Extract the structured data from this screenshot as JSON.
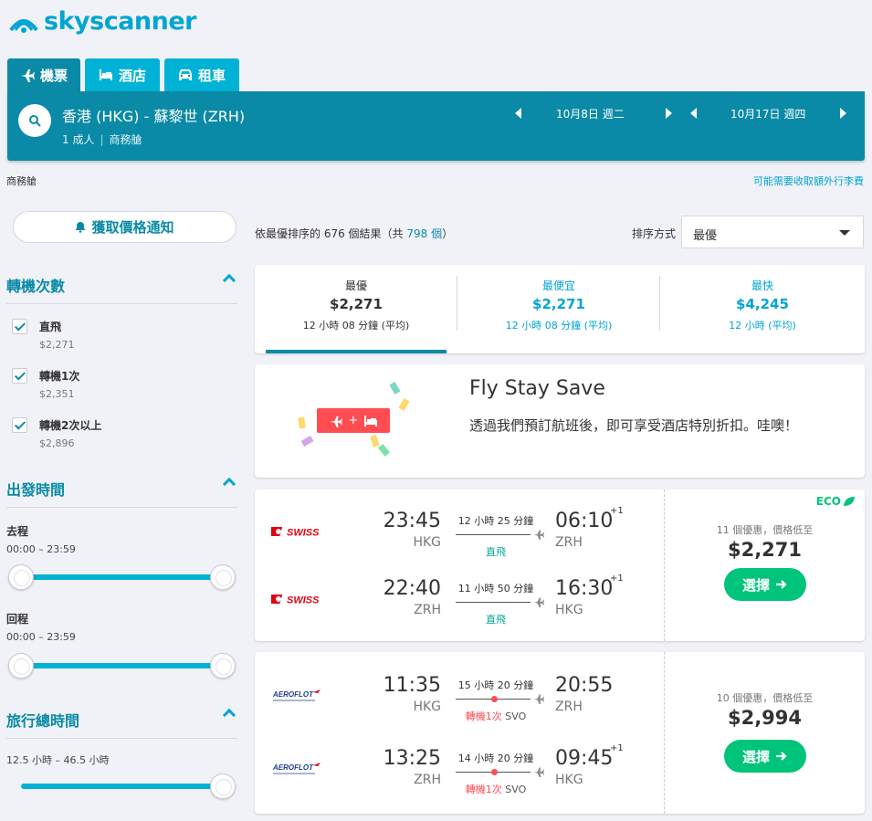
{
  "brand": {
    "name": "skyscanner",
    "color": "#00a5d2"
  },
  "tabs": [
    {
      "label": "機票",
      "icon": "plane-icon",
      "active": true
    },
    {
      "label": "酒店",
      "icon": "bed-icon",
      "active": false
    },
    {
      "label": "租車",
      "icon": "car-icon",
      "active": false
    }
  ],
  "search": {
    "route": "香港 (HKG) - 蘇黎世 (ZRH)",
    "passengers": "1 成人",
    "cabin": "商務艙",
    "depart_date": "10月8日 週二",
    "return_date": "10月17日 週四"
  },
  "cabin_label": "商務艙",
  "baggage_link": "可能需要收取額外行李費",
  "sidebar": {
    "alert_button": "獲取價格通知",
    "stops": {
      "title": "轉機次數",
      "options": [
        {
          "label": "直飛",
          "price": "$2,271",
          "checked": true
        },
        {
          "label": "轉機1次",
          "price": "$2,351",
          "checked": true
        },
        {
          "label": "轉機2次以上",
          "price": "$2,896",
          "checked": true
        }
      ]
    },
    "departure": {
      "title": "出發時間",
      "outbound_label": "去程",
      "outbound_range": "00:00 – 23:59",
      "return_label": "回程",
      "return_range": "00:00 – 23:59"
    },
    "duration": {
      "title": "旅行總時間",
      "range": "12.5 小時 – 46.5 小時"
    }
  },
  "results": {
    "count_prefix": "依最優排序的 676 個結果（共 ",
    "total": "798 個",
    "count_suffix": "）",
    "sort_label": "排序方式",
    "sort_value": "最優"
  },
  "sort_tabs": [
    {
      "title": "最優",
      "price": "$2,271",
      "time": "12 小時 08 分鐘 (平均)",
      "active": true
    },
    {
      "title": "最便宜",
      "price": "$2,271",
      "time": "12 小時 08 分鐘 (平均)",
      "active": false
    },
    {
      "title": "最快",
      "price": "$4,245",
      "time": "12 小時 (平均)",
      "active": false
    }
  ],
  "promo": {
    "title": "Fly Stay Save",
    "text": "透過我們預訂航班後，即可享受酒店特別折扣。哇噢！",
    "badge_plus": "+"
  },
  "flights": [
    {
      "airline": "SWISS",
      "eco": "ECO",
      "deals": "11 個優惠，價格低至",
      "price": "$2,271",
      "select": "選擇",
      "legs": [
        {
          "dep_time": "23:45",
          "dep_code": "HKG",
          "arr_time": "06:10",
          "arr_code": "ZRH",
          "plus": "+1",
          "duration": "12 小時 25 分鐘",
          "stops": "直飛",
          "via": ""
        },
        {
          "dep_time": "22:40",
          "dep_code": "ZRH",
          "arr_time": "16:30",
          "arr_code": "HKG",
          "plus": "+1",
          "duration": "11 小時 50 分鐘",
          "stops": "直飛",
          "via": ""
        }
      ]
    },
    {
      "airline": "AEROFLOT",
      "eco": "",
      "deals": "10 個優惠，價格低至",
      "price": "$2,994",
      "select": "選擇",
      "legs": [
        {
          "dep_time": "11:35",
          "dep_code": "HKG",
          "arr_time": "20:55",
          "arr_code": "ZRH",
          "plus": "",
          "duration": "15 小時 20 分鐘",
          "stops": "轉機1次",
          "via": "SVO"
        },
        {
          "dep_time": "13:25",
          "dep_code": "ZRH",
          "arr_time": "09:45",
          "arr_code": "HKG",
          "plus": "+1",
          "duration": "14 小時 20 分鐘",
          "stops": "轉機1次",
          "via": "SVO"
        }
      ]
    }
  ],
  "colors": {
    "primary": "#0a8aa6",
    "accent": "#00b3d6",
    "green": "#00c47b",
    "red": "#ff4d52"
  }
}
